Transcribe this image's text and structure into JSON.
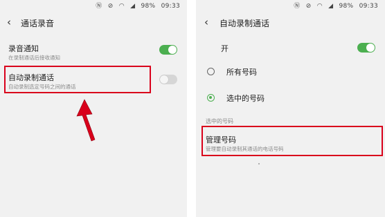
{
  "statusbar": {
    "icons": [
      "nfc-icon",
      "mute-icon",
      "wifi-icon",
      "signal-icon"
    ],
    "battery": "98%",
    "time": "09:33"
  },
  "left": {
    "title": "通话录音",
    "items": [
      {
        "label": "录音通知",
        "subtitle": "在录制通话后接收通知",
        "toggle": "on"
      },
      {
        "label": "自动录制通话",
        "subtitle": "自动录制选定号码之间的通话",
        "toggle": "off"
      }
    ]
  },
  "right": {
    "title": "自动录制通话",
    "master": {
      "label": "开",
      "toggle": "on"
    },
    "options": [
      {
        "label": "所有号码",
        "selected": false
      },
      {
        "label": "选中的号码",
        "selected": true
      }
    ],
    "section_header": "选中的号码",
    "manage": {
      "label": "管理号码",
      "subtitle": "管理要自动录制其通话的电话号码"
    }
  },
  "colors": {
    "accent": "#4caf50",
    "highlight": "#d9001b"
  }
}
